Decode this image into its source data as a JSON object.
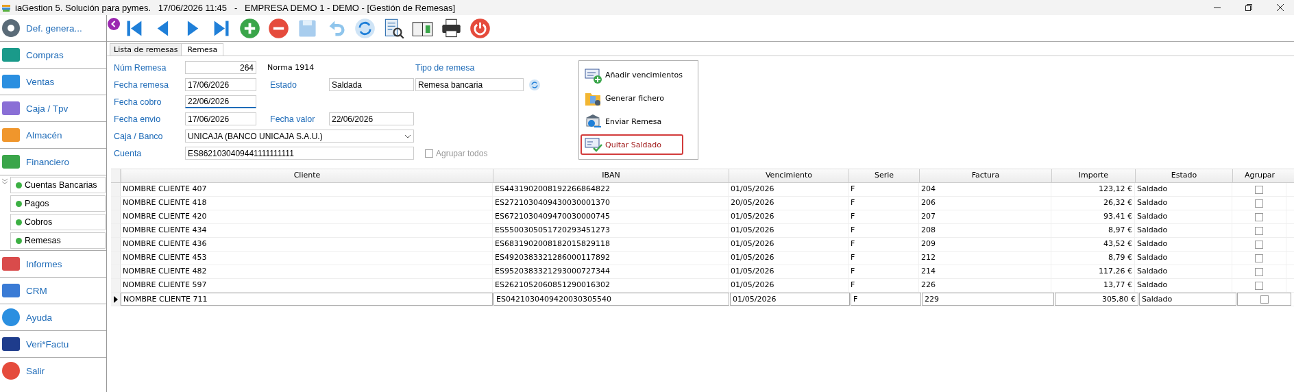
{
  "window": {
    "title": "iaGestion 5. Solución para pymes.   17/06/2026 11:45   -   EMPRESA DEMO 1 - DEMO - [Gestión de Remesas]"
  },
  "sidebar": {
    "items": [
      {
        "label": "Def. genera..."
      },
      {
        "label": "Compras"
      },
      {
        "label": "Ventas"
      },
      {
        "label": "Caja / Tpv"
      },
      {
        "label": "Almacén"
      },
      {
        "label": "Financiero",
        "expanded": true,
        "children": [
          {
            "label": "Cuentas Bancarias"
          },
          {
            "label": "Pagos"
          },
          {
            "label": "Cobros"
          },
          {
            "label": "Remesas"
          }
        ]
      },
      {
        "label": "Informes"
      },
      {
        "label": "CRM"
      },
      {
        "label": "Ayuda"
      },
      {
        "label": "Veri*Factu"
      },
      {
        "label": "Salir"
      }
    ]
  },
  "tabs": [
    {
      "label": "Lista de remesas",
      "selected": false
    },
    {
      "label": "Remesa",
      "selected": true
    }
  ],
  "form": {
    "num_remesa": {
      "label": "Núm Remesa",
      "value": "264"
    },
    "norma": "Norma 1914",
    "tipo_remesa": {
      "label": "Tipo de remesa",
      "value": "Remesa bancaria"
    },
    "fecha_remesa": {
      "label": "Fecha remesa",
      "value": "17/06/2026"
    },
    "estado": {
      "label": "Estado",
      "value": "Saldada"
    },
    "fecha_cobro": {
      "label": "Fecha cobro",
      "value": "22/06/2026",
      "focused": true
    },
    "fecha_envio": {
      "label": "Fecha envio",
      "value": "17/06/2026"
    },
    "fecha_valor": {
      "label": "Fecha valor",
      "value": "22/06/2026"
    },
    "caja_banco": {
      "label": "Caja / Banco",
      "value": "UNICAJA (BANCO UNICAJA S.A.U.)"
    },
    "cuenta": {
      "label": "Cuenta",
      "value": "ES8621030409441111111111"
    },
    "agrupar_todos": {
      "label": "Agrupar todos",
      "checked": false,
      "disabled": true
    }
  },
  "actions": [
    {
      "label": "Añadir vencimientos",
      "selected": false
    },
    {
      "label": "Generar fichero",
      "selected": false
    },
    {
      "label": "Enviar Remesa",
      "selected": false
    },
    {
      "label": "Quitar Saldado",
      "selected": true
    }
  ],
  "table": {
    "columns": [
      "Cliente",
      "IBAN",
      "Vencimiento",
      "Serie",
      "Factura",
      "Importe",
      "Estado",
      "Agrupar"
    ],
    "rows": [
      {
        "cells": [
          "NOMBRE CLIENTE 407",
          "ES4431902008192266864822",
          "01/05/2026",
          "F",
          "204",
          "123,12 €",
          "Saldado"
        ],
        "agrupar": false,
        "selected": false
      },
      {
        "cells": [
          "NOMBRE CLIENTE 418",
          "ES2721030409430030001370",
          "20/05/2026",
          "F",
          "206",
          "26,32 €",
          "Saldado"
        ],
        "agrupar": false,
        "selected": false
      },
      {
        "cells": [
          "NOMBRE CLIENTE 420",
          "ES6721030409470030000745",
          "01/05/2026",
          "F",
          "207",
          "93,41 €",
          "Saldado"
        ],
        "agrupar": false,
        "selected": false
      },
      {
        "cells": [
          "NOMBRE CLIENTE 434",
          "ES5500305051720293451273",
          "01/05/2026",
          "F",
          "208",
          "8,97 €",
          "Saldado"
        ],
        "agrupar": false,
        "selected": false
      },
      {
        "cells": [
          "NOMBRE CLIENTE 436",
          "ES6831902008182015829118",
          "01/05/2026",
          "F",
          "209",
          "43,52 €",
          "Saldado"
        ],
        "agrupar": false,
        "selected": false
      },
      {
        "cells": [
          "NOMBRE CLIENTE 453",
          "ES4920383321286000117892",
          "01/05/2026",
          "F",
          "212",
          "8,79 €",
          "Saldado"
        ],
        "agrupar": false,
        "selected": false
      },
      {
        "cells": [
          "NOMBRE CLIENTE 482",
          "ES9520383321293000727344",
          "01/05/2026",
          "F",
          "214",
          "117,26 €",
          "Saldado"
        ],
        "agrupar": false,
        "selected": false
      },
      {
        "cells": [
          "NOMBRE CLIENTE 597",
          "ES2621052060851290016302",
          "01/05/2026",
          "F",
          "226",
          "13,77 €",
          "Saldado"
        ],
        "agrupar": false,
        "selected": false
      },
      {
        "cells": [
          "NOMBRE CLIENTE 711",
          "ES0421030409420030305540",
          "01/05/2026",
          "F",
          "229",
          "305,80 €",
          "Saldado"
        ],
        "agrupar": false,
        "selected": true
      }
    ]
  }
}
